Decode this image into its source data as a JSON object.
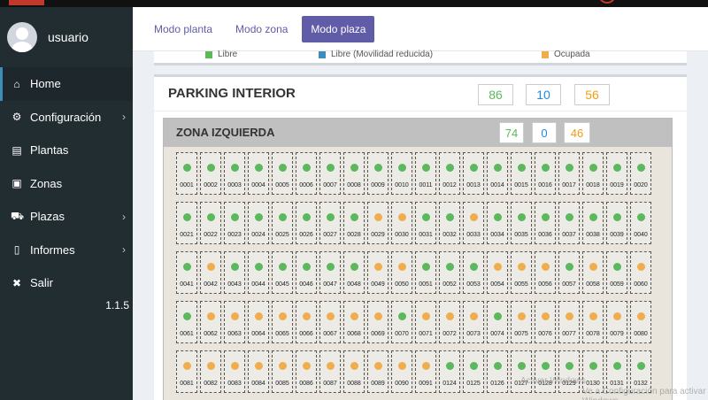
{
  "user": {
    "name": "usuario"
  },
  "sidebar": {
    "items": [
      {
        "label": "Home",
        "icon": "home-icon",
        "glyph": "⌂",
        "chevron": false,
        "active": true
      },
      {
        "label": "Configuración",
        "icon": "gear-icon",
        "glyph": "⚙",
        "chevron": true,
        "active": false
      },
      {
        "label": "Plantas",
        "icon": "building-icon",
        "glyph": "▤",
        "chevron": false,
        "active": false
      },
      {
        "label": "Zonas",
        "icon": "map-icon",
        "glyph": "▣",
        "chevron": false,
        "active": false
      },
      {
        "label": "Plazas",
        "icon": "car-icon",
        "glyph": "⛟",
        "chevron": true,
        "active": false
      },
      {
        "label": "Informes",
        "icon": "file-icon",
        "glyph": "▯",
        "chevron": true,
        "active": false
      },
      {
        "label": "Salir",
        "icon": "close-icon",
        "glyph": "✖",
        "chevron": false,
        "active": false
      }
    ],
    "version": "1.1.5"
  },
  "tabs": [
    {
      "label": "Modo planta",
      "active": false
    },
    {
      "label": "Modo zona",
      "active": false
    },
    {
      "label": "Modo plaza",
      "active": true
    }
  ],
  "legend": {
    "libre": "Libre",
    "reducida": "Libre (Movilidad reducida)",
    "ocupada": "Ocupada"
  },
  "colors": {
    "libre": "#5cb85c",
    "reducida": "#3c8dbc",
    "ocupada": "#f0ad4e",
    "libre_text": "#5cb85c",
    "reducida_text": "#1e88e5",
    "ocupada_text": "#f39c12"
  },
  "parking": {
    "title": "PARKING INTERIOR",
    "libre": "86",
    "reducida": "10",
    "ocupada": "56"
  },
  "zone": {
    "title": "ZONA IZQUIERDA",
    "libre": "74",
    "reducida": "0",
    "ocupada": "46"
  },
  "spots": [
    [
      "0001",
      "L"
    ],
    [
      "0002",
      "L"
    ],
    [
      "0003",
      "L"
    ],
    [
      "0004",
      "L"
    ],
    [
      "0005",
      "L"
    ],
    [
      "0006",
      "L"
    ],
    [
      "0007",
      "L"
    ],
    [
      "0008",
      "L"
    ],
    [
      "0009",
      "L"
    ],
    [
      "0010",
      "L"
    ],
    [
      "0011",
      "L"
    ],
    [
      "0012",
      "L"
    ],
    [
      "0013",
      "L"
    ],
    [
      "0014",
      "L"
    ],
    [
      "0015",
      "L"
    ],
    [
      "0016",
      "L"
    ],
    [
      "0017",
      "L"
    ],
    [
      "0018",
      "L"
    ],
    [
      "0019",
      "L"
    ],
    [
      "0020",
      "L"
    ],
    [
      "0021",
      "L"
    ],
    [
      "0022",
      "L"
    ],
    [
      "0023",
      "L"
    ],
    [
      "0024",
      "L"
    ],
    [
      "0025",
      "L"
    ],
    [
      "0026",
      "L"
    ],
    [
      "0027",
      "L"
    ],
    [
      "0028",
      "L"
    ],
    [
      "0029",
      "O"
    ],
    [
      "0030",
      "O"
    ],
    [
      "0031",
      "L"
    ],
    [
      "0032",
      "L"
    ],
    [
      "0033",
      "O"
    ],
    [
      "0034",
      "L"
    ],
    [
      "0035",
      "L"
    ],
    [
      "0036",
      "L"
    ],
    [
      "0037",
      "L"
    ],
    [
      "0038",
      "L"
    ],
    [
      "0039",
      "L"
    ],
    [
      "0040",
      "L"
    ],
    [
      "0041",
      "L"
    ],
    [
      "0042",
      "O"
    ],
    [
      "0043",
      "L"
    ],
    [
      "0044",
      "L"
    ],
    [
      "0045",
      "L"
    ],
    [
      "0046",
      "L"
    ],
    [
      "0047",
      "L"
    ],
    [
      "0048",
      "L"
    ],
    [
      "0049",
      "O"
    ],
    [
      "0050",
      "O"
    ],
    [
      "0051",
      "L"
    ],
    [
      "0052",
      "L"
    ],
    [
      "0053",
      "L"
    ],
    [
      "0054",
      "O"
    ],
    [
      "0055",
      "O"
    ],
    [
      "0056",
      "O"
    ],
    [
      "0057",
      "L"
    ],
    [
      "0058",
      "O"
    ],
    [
      "0059",
      "L"
    ],
    [
      "0060",
      "O"
    ],
    [
      "0061",
      "L"
    ],
    [
      "0062",
      "O"
    ],
    [
      "0063",
      "O"
    ],
    [
      "0064",
      "O"
    ],
    [
      "0065",
      "O"
    ],
    [
      "0066",
      "O"
    ],
    [
      "0067",
      "O"
    ],
    [
      "0068",
      "O"
    ],
    [
      "0069",
      "O"
    ],
    [
      "0070",
      "L"
    ],
    [
      "0071",
      "O"
    ],
    [
      "0072",
      "O"
    ],
    [
      "0073",
      "O"
    ],
    [
      "0074",
      "L"
    ],
    [
      "0075",
      "O"
    ],
    [
      "0076",
      "O"
    ],
    [
      "0077",
      "O"
    ],
    [
      "0078",
      "O"
    ],
    [
      "0079",
      "O"
    ],
    [
      "0080",
      "O"
    ],
    [
      "0081",
      "O"
    ],
    [
      "0082",
      "O"
    ],
    [
      "0083",
      "O"
    ],
    [
      "0084",
      "O"
    ],
    [
      "0085",
      "O"
    ],
    [
      "0086",
      "O"
    ],
    [
      "0087",
      "O"
    ],
    [
      "0088",
      "O"
    ],
    [
      "0089",
      "O"
    ],
    [
      "0090",
      "O"
    ],
    [
      "0091",
      "O"
    ],
    [
      "0124",
      "L"
    ],
    [
      "0125",
      "L"
    ],
    [
      "0126",
      "L"
    ],
    [
      "0127",
      "L"
    ],
    [
      "0128",
      "L"
    ],
    [
      "0129",
      "L"
    ],
    [
      "0130",
      "L"
    ],
    [
      "0131",
      "L"
    ],
    [
      "0132",
      "L"
    ]
  ],
  "watermark": {
    "line1": "Activar Windows",
    "line2": "Ve a Configuración para activar Windows."
  }
}
